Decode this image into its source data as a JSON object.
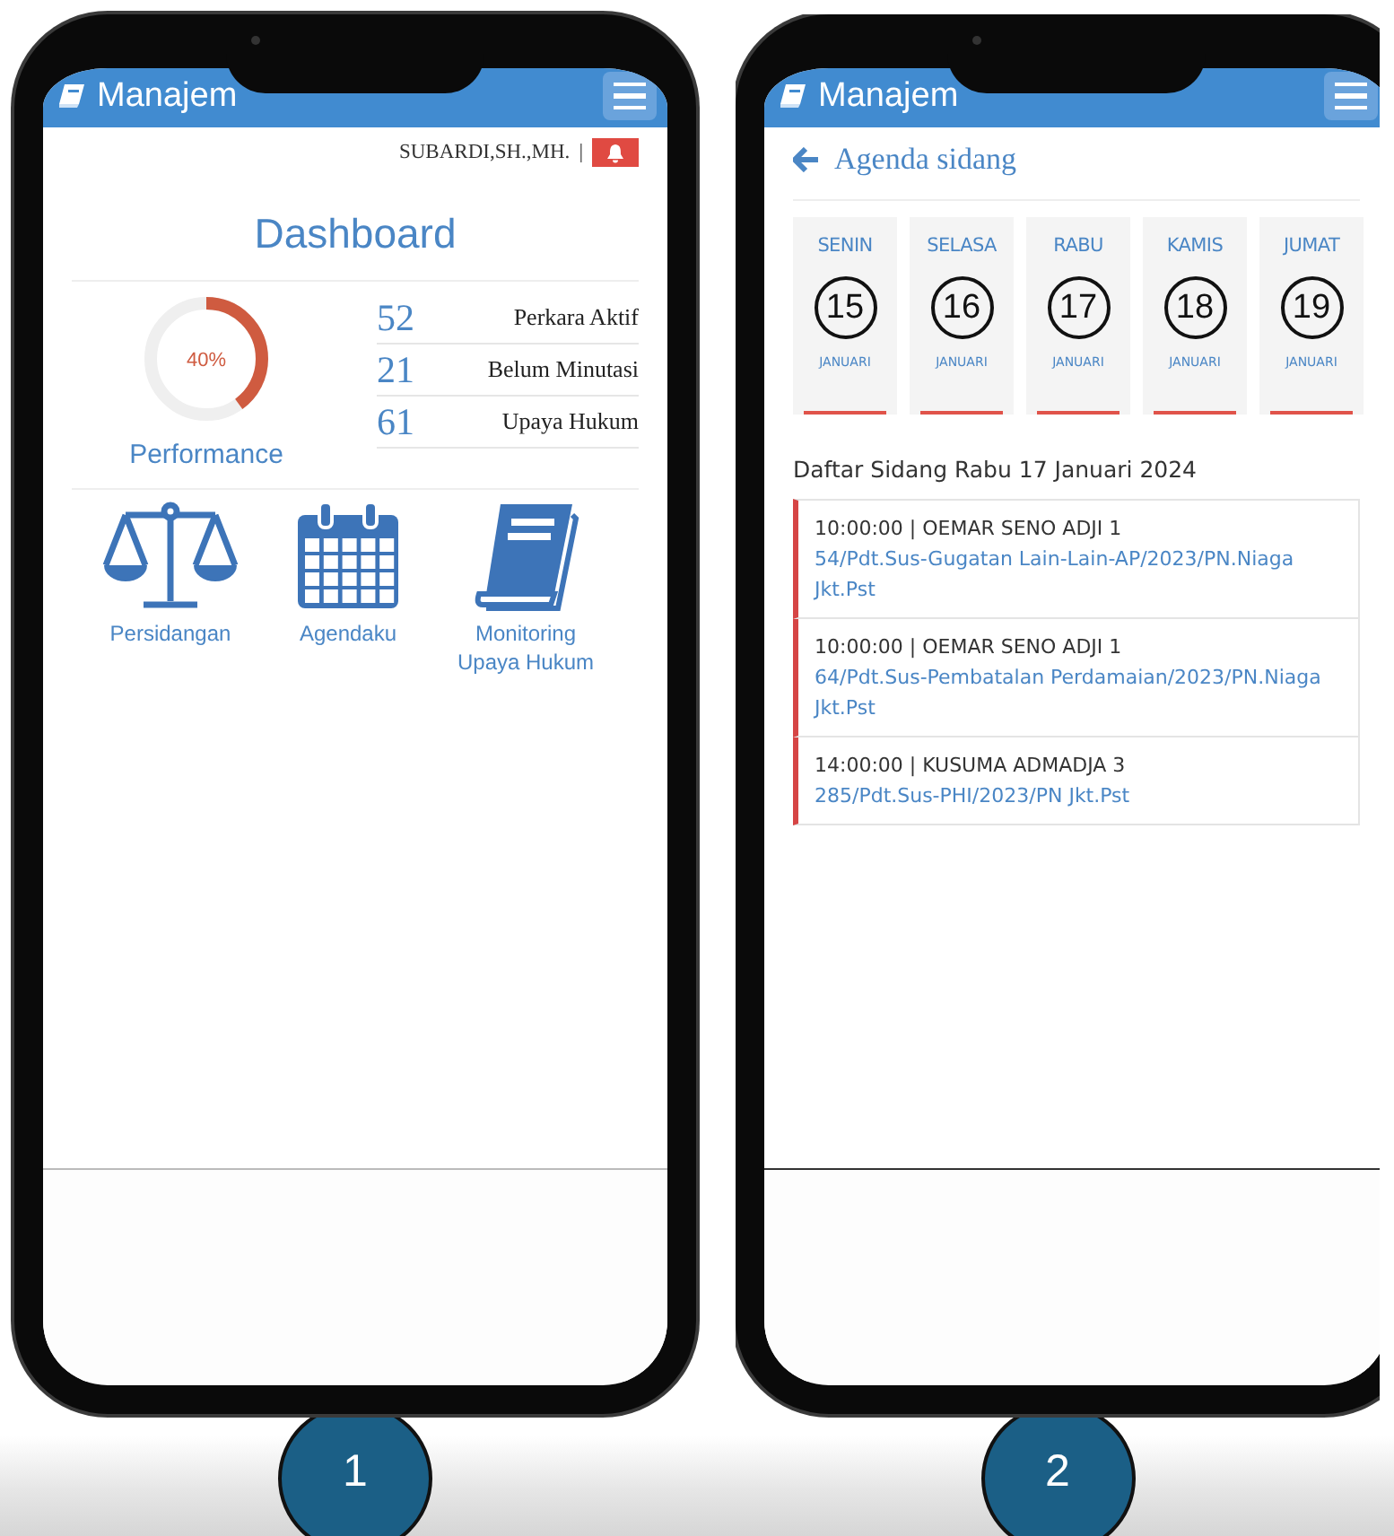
{
  "phones": [
    {
      "kind": "dashboard",
      "step": "1",
      "app_title": "Manajem",
      "user": "SUBARDI,SH.,MH.",
      "separator": "|",
      "page_title": "Dashboard",
      "performance": {
        "value_label": "40%",
        "level": 0.4,
        "label": "Performance"
      },
      "stats": [
        {
          "value": "52",
          "label": "Perkara Aktif"
        },
        {
          "value": "21",
          "label": "Belum Minutasi"
        },
        {
          "value": "61",
          "label": "Upaya Hukum"
        }
      ],
      "shortcuts": [
        {
          "kind": "scales",
          "label": "Persidangan"
        },
        {
          "kind": "calendar",
          "label": "Agendaku"
        },
        {
          "kind": "book",
          "label": "Monitoring Upaya Hukum"
        }
      ]
    },
    {
      "kind": "agenda",
      "step": "2",
      "app_title": "Manajem",
      "page_title": "Agenda sidang",
      "days": [
        {
          "day": "SENIN",
          "date": "15",
          "month": "JANUARI"
        },
        {
          "day": "SELASA",
          "date": "16",
          "month": "JANUARI"
        },
        {
          "day": "RABU",
          "date": "17",
          "month": "JANUARI"
        },
        {
          "day": "KAMIS",
          "date": "18",
          "month": "JANUARI"
        },
        {
          "day": "JUMAT",
          "date": "19",
          "month": "JANUARI"
        }
      ],
      "list_title": "Daftar Sidang Rabu 17 Januari 2024",
      "hearings": [
        {
          "time_room": "10:00:00 | OEMAR SENO ADJI 1",
          "case": "54/Pdt.Sus-Gugatan Lain-Lain-AP/2023/PN.Niaga Jkt.Pst"
        },
        {
          "time_room": "10:00:00 | OEMAR SENO ADJI 1",
          "case": "64/Pdt.Sus-Pembatalan Perdamaian/2023/PN.Niaga Jkt.Pst"
        },
        {
          "time_room": "14:00:00 | KUSUMA ADMADJA 3",
          "case": "285/Pdt.Sus-PHI/2023/PN Jkt.Pst"
        }
      ]
    }
  ]
}
